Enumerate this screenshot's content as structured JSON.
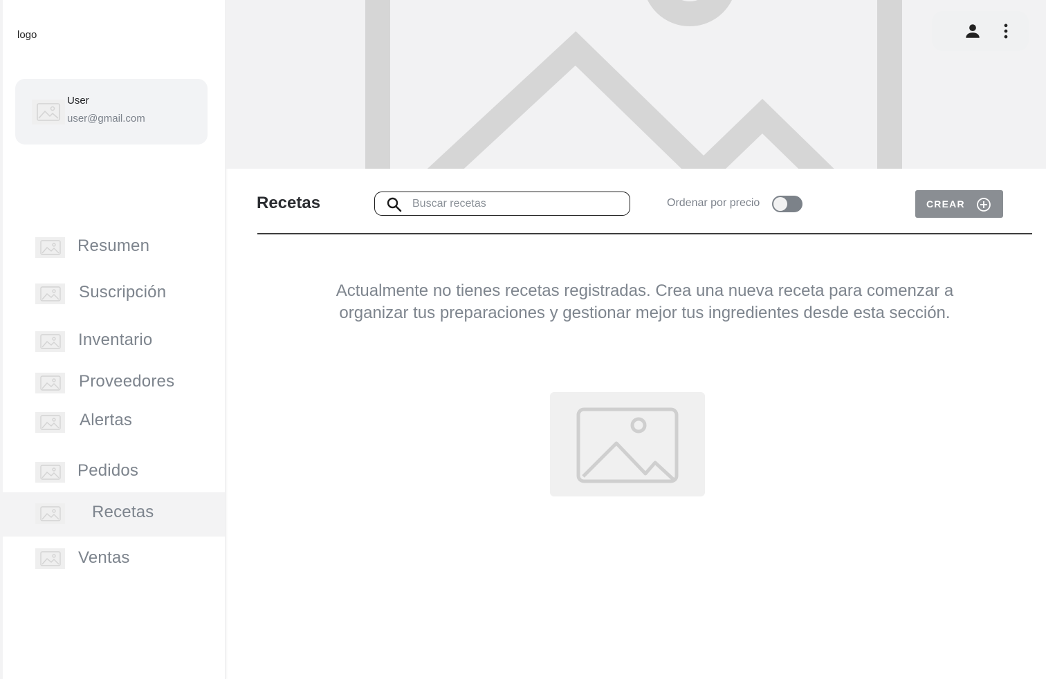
{
  "sidebar": {
    "logo": "logo",
    "user": {
      "name": "User",
      "email": "user@gmail.com"
    },
    "items": [
      {
        "label": "Resumen",
        "active": false
      },
      {
        "label": "Suscripción",
        "active": false
      },
      {
        "label": "Inventario",
        "active": false
      },
      {
        "label": "Proveedores",
        "active": false
      },
      {
        "label": "Alertas",
        "active": false
      },
      {
        "label": "Pedidos",
        "active": false
      },
      {
        "label": "Recetas",
        "active": true
      },
      {
        "label": "Ventas",
        "active": false
      }
    ]
  },
  "header": {
    "actions": [
      "user-icon",
      "more-vertical-icon"
    ]
  },
  "toolbar": {
    "title": "Recetas",
    "search_placeholder": "Buscar recetas",
    "search_value": "",
    "sort_label": "Ordenar por precio",
    "sort_enabled": false,
    "create_label": "CREAR"
  },
  "empty_state": {
    "message": "Actualmente no tienes recetas registradas. Crea una nueva receta para comenzar a organizar tus preparaciones y gestionar mejor tus ingredientes desde esta sección."
  },
  "colors": {
    "accent_gray": "#8a8e93",
    "text_muted": "#7d848d",
    "active_bg": "#f3f3f4"
  }
}
